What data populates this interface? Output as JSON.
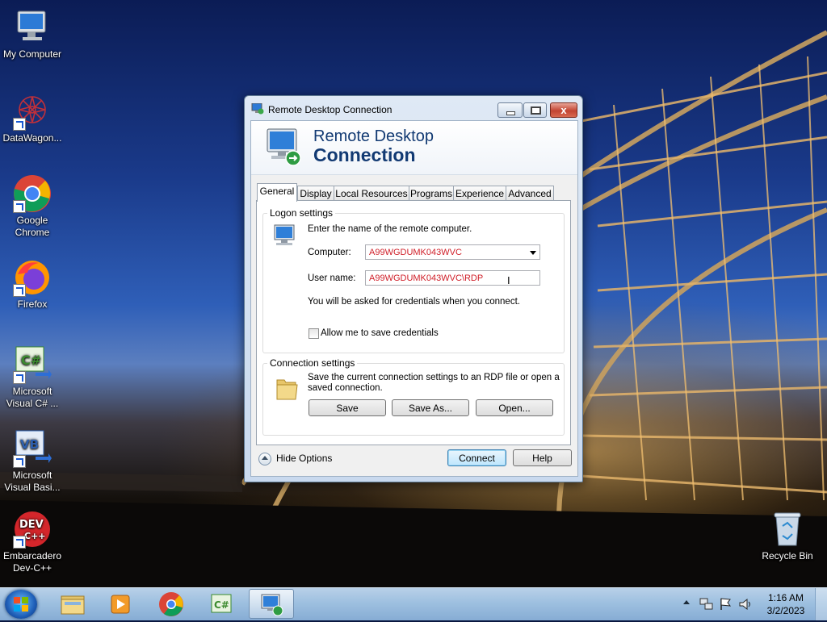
{
  "desktop": {
    "icons": [
      {
        "label": "My Computer"
      },
      {
        "label": "DataWagon..."
      },
      {
        "label": "Google Chrome"
      },
      {
        "label": "Firefox"
      },
      {
        "label": "Microsoft Visual C# ..."
      },
      {
        "label": "Microsoft Visual Basi..."
      },
      {
        "label": "Embarcadero Dev-C++"
      },
      {
        "label": "Recycle Bin"
      }
    ]
  },
  "window": {
    "title": "Remote Desktop Connection",
    "banner": {
      "line1": "Remote Desktop",
      "line2": "Connection"
    },
    "close_glyph": "x",
    "tabs": [
      {
        "label": "General",
        "active": true
      },
      {
        "label": "Display"
      },
      {
        "label": "Local Resources"
      },
      {
        "label": "Programs"
      },
      {
        "label": "Experience"
      },
      {
        "label": "Advanced"
      }
    ],
    "logon": {
      "group_label": "Logon settings",
      "instruction": "Enter the name of the remote computer.",
      "computer_label": "Computer:",
      "computer_value": "A99WGDUMK043WVC",
      "username_label": "User name:",
      "username_value": "A99WGDUMK043WVC\\RDP",
      "credentials_note": "You will be asked for credentials when you connect.",
      "save_credentials_label": "Allow me to save credentials",
      "save_credentials_checked": false
    },
    "connection": {
      "group_label": "Connection settings",
      "description_line1": "Save the current connection settings to an RDP file or open a",
      "description_line2": "saved connection.",
      "save_label": "Save",
      "save_as_label": "Save As...",
      "open_label": "Open..."
    },
    "footer": {
      "hide_options_label": "Hide Options",
      "connect_label": "Connect",
      "help_label": "Help"
    }
  },
  "taskbar": {
    "clock_time": "1:16 AM",
    "clock_date": "3/2/2023"
  },
  "colors": {
    "field_text": "#d0202a",
    "banner_title": "#123a73",
    "taskbar": "#9ec0e0"
  }
}
